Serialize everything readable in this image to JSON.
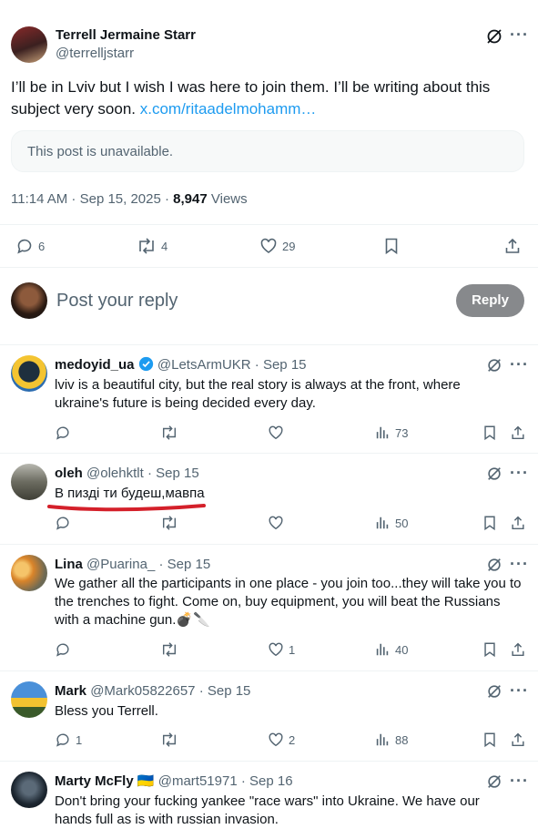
{
  "main_post": {
    "author_name": "Terrell Jermaine Starr",
    "author_handle": "@terrelljstarr",
    "text": "I’ll be in Lviv but I wish I was here to join them. I’ll be writing about this subject very soon. ",
    "link": "x.com/ritaadelmohamm…",
    "quote_unavailable": "This post is unavailable.",
    "time": "11:14 AM · Sep 15, 2025 · ",
    "views_count": "8,947",
    "views_label": " Views",
    "replies": "6",
    "reposts": "4",
    "likes": "29"
  },
  "composer": {
    "placeholder": "Post your reply",
    "reply_button": "Reply"
  },
  "replies": [
    {
      "name": "medoyid_ua",
      "verified": true,
      "handle": "@LetsArmUKR",
      "date": "· Sep 15",
      "text": "lviv is a beautiful city, but the real story is always at the front, where ukraine's future is being decided every day.",
      "likes": "",
      "views": "73"
    },
    {
      "name": "oleh",
      "handle": "@olehktlt",
      "date": "· Sep 15",
      "text": "В пизді ти будеш,мавпа",
      "likes": "",
      "views": "50"
    },
    {
      "name": "Lina",
      "handle": "@Puarina_",
      "date": "· Sep 15",
      "text": "We gather all the participants in one place - you join too...they will take you to the trenches to fight. Come on, buy equipment, you will beat the Russians with a machine gun.💣🔪",
      "likes": "1",
      "views": "40"
    },
    {
      "name": "Mark",
      "handle": "@Mark05822657",
      "date": "· Sep 15",
      "text": "Bless you Terrell.",
      "replies": "1",
      "likes": "2",
      "views": "88"
    },
    {
      "name": "Marty McFly",
      "flag": "🇺🇦",
      "handle": "@mart51971",
      "date": "· Sep 16",
      "text": "Don't bring your fucking yankee \"race wars\" into Ukraine. We have our hands full as is with russian invasion."
    }
  ],
  "colors": {
    "text": "#0f1419",
    "secondary": "#536471",
    "link": "#1d9bf0",
    "reply_button": "#87898c",
    "annotation_red": "#d4202a"
  }
}
